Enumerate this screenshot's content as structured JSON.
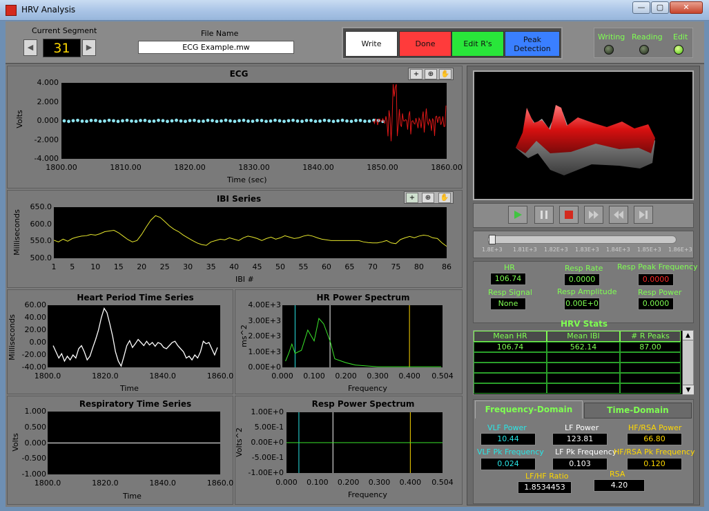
{
  "window": {
    "title": "HRV Analysis",
    "minimize": "—",
    "maximize": "▢",
    "close": "✕"
  },
  "segment": {
    "label": "Current Segment",
    "value": "31",
    "prev": "◀",
    "next": "▶"
  },
  "file": {
    "label": "File Name",
    "value": "ECG Example.mw"
  },
  "buttons": {
    "write": "Write",
    "done": "Done",
    "edit_rs": "Edit R's",
    "peak_detection": "Peak Detection"
  },
  "status": {
    "writing": "Writing",
    "reading": "Reading",
    "edit": "Edit",
    "edit_on": true
  },
  "ecg": {
    "title": "ECG",
    "xlabel": "Time (sec)",
    "ylabel": "Volts",
    "yticks": [
      "4.000",
      "2.000",
      "0.000",
      "-2.000",
      "-4.000"
    ],
    "xticks": [
      "1800.00",
      "1810.00",
      "1820.00",
      "1830.00",
      "1840.00",
      "1850.00",
      "1860.00"
    ]
  },
  "ibi": {
    "title": "IBI Series",
    "xlabel": "IBI #",
    "ylabel": "Milliseconds",
    "yticks": [
      "650.0",
      "600.0",
      "550.0",
      "500.0"
    ],
    "xticks": [
      "1",
      "5",
      "10",
      "15",
      "20",
      "25",
      "30",
      "35",
      "40",
      "45",
      "50",
      "55",
      "60",
      "65",
      "70",
      "75",
      "80",
      "86"
    ]
  },
  "hpts": {
    "title": "Heart Period Time Series",
    "xlabel": "Time",
    "ylabel": "Milliseconds",
    "yticks": [
      "60.00",
      "40.00",
      "20.00",
      "0.00",
      "-20.00",
      "-40.00"
    ],
    "xticks": [
      "1800.0",
      "1820.0",
      "1840.0",
      "1860.0"
    ]
  },
  "hrps": {
    "title": "HR Power Spectrum",
    "xlabel": "Frequency",
    "ylabel": "ms^2",
    "yticks": [
      "4.00E+3",
      "3.00E+3",
      "2.00E+3",
      "1.00E+3",
      "0.00E+0"
    ],
    "xticks": [
      "0.000",
      "0.100",
      "0.200",
      "0.300",
      "0.400",
      "0.504"
    ]
  },
  "rts": {
    "title": "Respiratory Time Series",
    "xlabel": "Time",
    "ylabel": "Volts",
    "yticks": [
      "1.000",
      "0.500",
      "0.000",
      "-0.500",
      "-1.000"
    ],
    "xticks": [
      "1800.0",
      "1820.0",
      "1840.0",
      "1860.0"
    ]
  },
  "rps": {
    "title": "Resp Power Spectrum",
    "xlabel": "Frequency",
    "ylabel": "Volts^2",
    "yticks": [
      "1.00E+0",
      "5.00E-1",
      "0.00E+0",
      "-5.00E-1",
      "-1.00E+0"
    ],
    "xticks": [
      "0.000",
      "0.100",
      "0.200",
      "0.300",
      "0.400",
      "0.504"
    ]
  },
  "slider": {
    "ticks": [
      "1.8E+3",
      "1.81E+3",
      "1.82E+3",
      "1.83E+3",
      "1.84E+3",
      "1.85E+3",
      "1.86E+3"
    ]
  },
  "stats_top": {
    "hr_label": "HR",
    "hr": "106.74",
    "resp_rate_label": "Resp Rate",
    "resp_rate": "0.0000",
    "resp_peak_freq_label": "Resp Peak Frequency",
    "resp_peak_freq": "0.0000",
    "resp_signal_label": "Resp Signal",
    "resp_signal": "None",
    "resp_amplitude_label": "Resp Amplitude",
    "resp_amplitude": "0.00E+0",
    "resp_power_label": "Resp Power",
    "resp_power": "0.0000"
  },
  "hrv_stats": {
    "title": "HRV Stats",
    "columns": [
      "Mean HR",
      "Mean IBI",
      "# R Peaks"
    ],
    "rows": [
      [
        "106.74",
        "562.14",
        "87.00"
      ]
    ]
  },
  "tabs": {
    "freq": "Frequency-Domain",
    "time": "Time-Domain"
  },
  "freq": {
    "vlf_power_label": "VLF  Power",
    "vlf_power": "10.44",
    "lf_power_label": "LF Power",
    "lf_power": "123.81",
    "hf_power_label": "HF/RSA Power",
    "hf_power": "66.80",
    "vlf_pk_label": "VLF Pk Frequency",
    "vlf_pk": "0.024",
    "lf_pk_label": "LF Pk Frequency",
    "lf_pk": "0.103",
    "hf_pk_label": "HF/RSA Pk Frequency",
    "hf_pk": "0.120",
    "lfhf_label": "LF/HF Ratio",
    "lfhf": "1.8534453",
    "rsa_label": "RSA",
    "rsa": "4.20"
  },
  "colors": {
    "green_label": "#7fff52",
    "yellow_label": "#ffd800",
    "cyan_label": "#29e6e6",
    "ecg_dots": "#8fe6f2",
    "ecg_tail": "#e01818",
    "ibi_line": "#e8e82c",
    "hpts_line": "#ffffff",
    "hrps_line": "#3ae62a"
  }
}
